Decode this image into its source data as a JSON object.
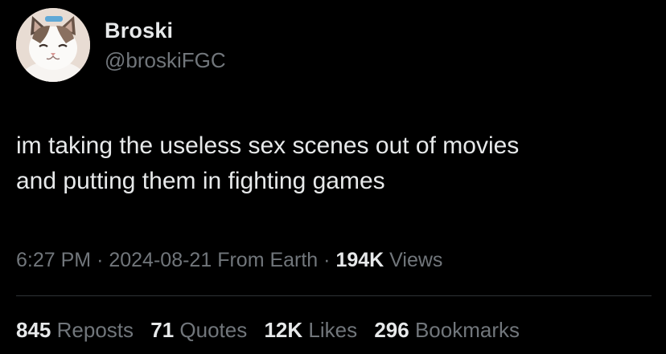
{
  "author": {
    "display_name": "Broski",
    "handle": "@broskiFGC",
    "avatar_icon": "cat-avatar-icon"
  },
  "tweet": {
    "text": "im taking the useless sex scenes out of movies\nand putting them in fighting games"
  },
  "meta": {
    "time": "6:27 PM",
    "separator": "·",
    "date": "2024-08-21",
    "source": "From Earth",
    "views_count": "194K",
    "views_label": "Views"
  },
  "stats": {
    "reposts_count": "845",
    "reposts_label": "Reposts",
    "quotes_count": "71",
    "quotes_label": "Quotes",
    "likes_count": "12K",
    "likes_label": "Likes",
    "bookmarks_count": "296",
    "bookmarks_label": "Bookmarks"
  },
  "colors": {
    "background": "#000000",
    "primary_text": "#e7e9ea",
    "secondary_text": "#71767b",
    "divider": "#2f3336"
  }
}
